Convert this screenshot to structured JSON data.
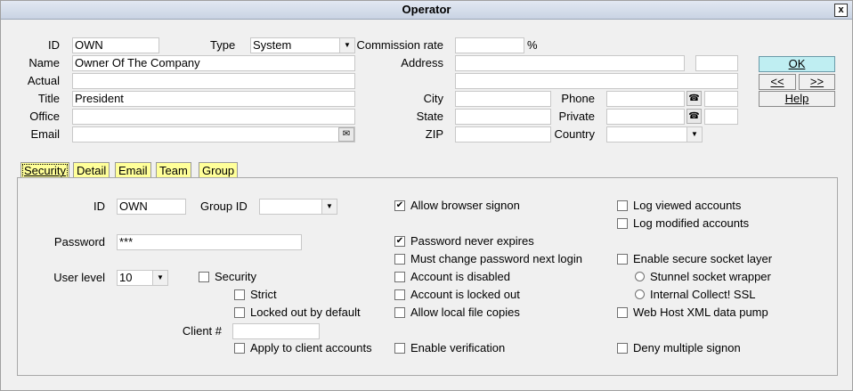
{
  "window": {
    "title": "Operator",
    "close": "x"
  },
  "top": {
    "id_label": "ID",
    "id_value": "OWN",
    "type_label": "Type",
    "type_value": "System",
    "commission_label": "Commission rate",
    "commission_value": "",
    "percent": "%",
    "name_label": "Name",
    "name_value": "Owner Of The Company",
    "actual_label": "Actual",
    "actual_value": "",
    "title_label": "Title",
    "title_value": "President",
    "office_label": "Office",
    "office_value": "",
    "email_label": "Email",
    "email_value": "",
    "address_label": "Address",
    "address_line1": "",
    "address_line1_extra": "",
    "address_line2": "",
    "city_label": "City",
    "city_value": "",
    "state_label": "State",
    "state_value": "",
    "zip_label": "ZIP",
    "zip_value": "",
    "phone_label": "Phone",
    "phone_value": "",
    "phone_ext": "",
    "private_label": "Private",
    "private_value": "",
    "private_ext": "",
    "country_label": "Country",
    "country_value": ""
  },
  "buttons": {
    "ok": "OK",
    "prev": "<<",
    "next": ">>",
    "help": "Help"
  },
  "tabs": [
    "Security",
    "Detail",
    "Email",
    "Team",
    "Group"
  ],
  "security": {
    "id_label": "ID",
    "id_value": "OWN",
    "group_label": "Group ID",
    "group_value": "",
    "password_label": "Password",
    "password_value": "***",
    "userlevel_label": "User level",
    "userlevel_value": "10",
    "client_label": "Client #",
    "client_value": "",
    "checks": {
      "security": {
        "label": "Security",
        "checked": false
      },
      "strict": {
        "label": "Strict",
        "checked": false
      },
      "locked_default": {
        "label": "Locked out by default",
        "checked": false
      },
      "apply_client": {
        "label": "Apply to client accounts",
        "checked": false
      },
      "allow_browser": {
        "label": "Allow browser signon",
        "checked": true
      },
      "pw_never": {
        "label": "Password never expires",
        "checked": true
      },
      "must_change": {
        "label": "Must change password next login",
        "checked": false
      },
      "disabled": {
        "label": "Account is disabled",
        "checked": false
      },
      "locked": {
        "label": "Account is locked out",
        "checked": false
      },
      "local_copies": {
        "label": "Allow local file copies",
        "checked": false
      },
      "verification": {
        "label": "Enable verification",
        "checked": false
      },
      "log_viewed": {
        "label": "Log viewed accounts",
        "checked": false
      },
      "log_modified": {
        "label": "Log modified accounts",
        "checked": false
      },
      "ssl": {
        "label": "Enable secure socket layer",
        "checked": false
      },
      "xml_pump": {
        "label": "Web Host XML data pump",
        "checked": false
      },
      "deny_multi": {
        "label": "Deny multiple signon",
        "checked": false
      }
    },
    "radios": {
      "stunnel": {
        "label": "Stunnel socket wrapper"
      },
      "internal_ssl": {
        "label": "Internal Collect! SSL"
      }
    }
  }
}
